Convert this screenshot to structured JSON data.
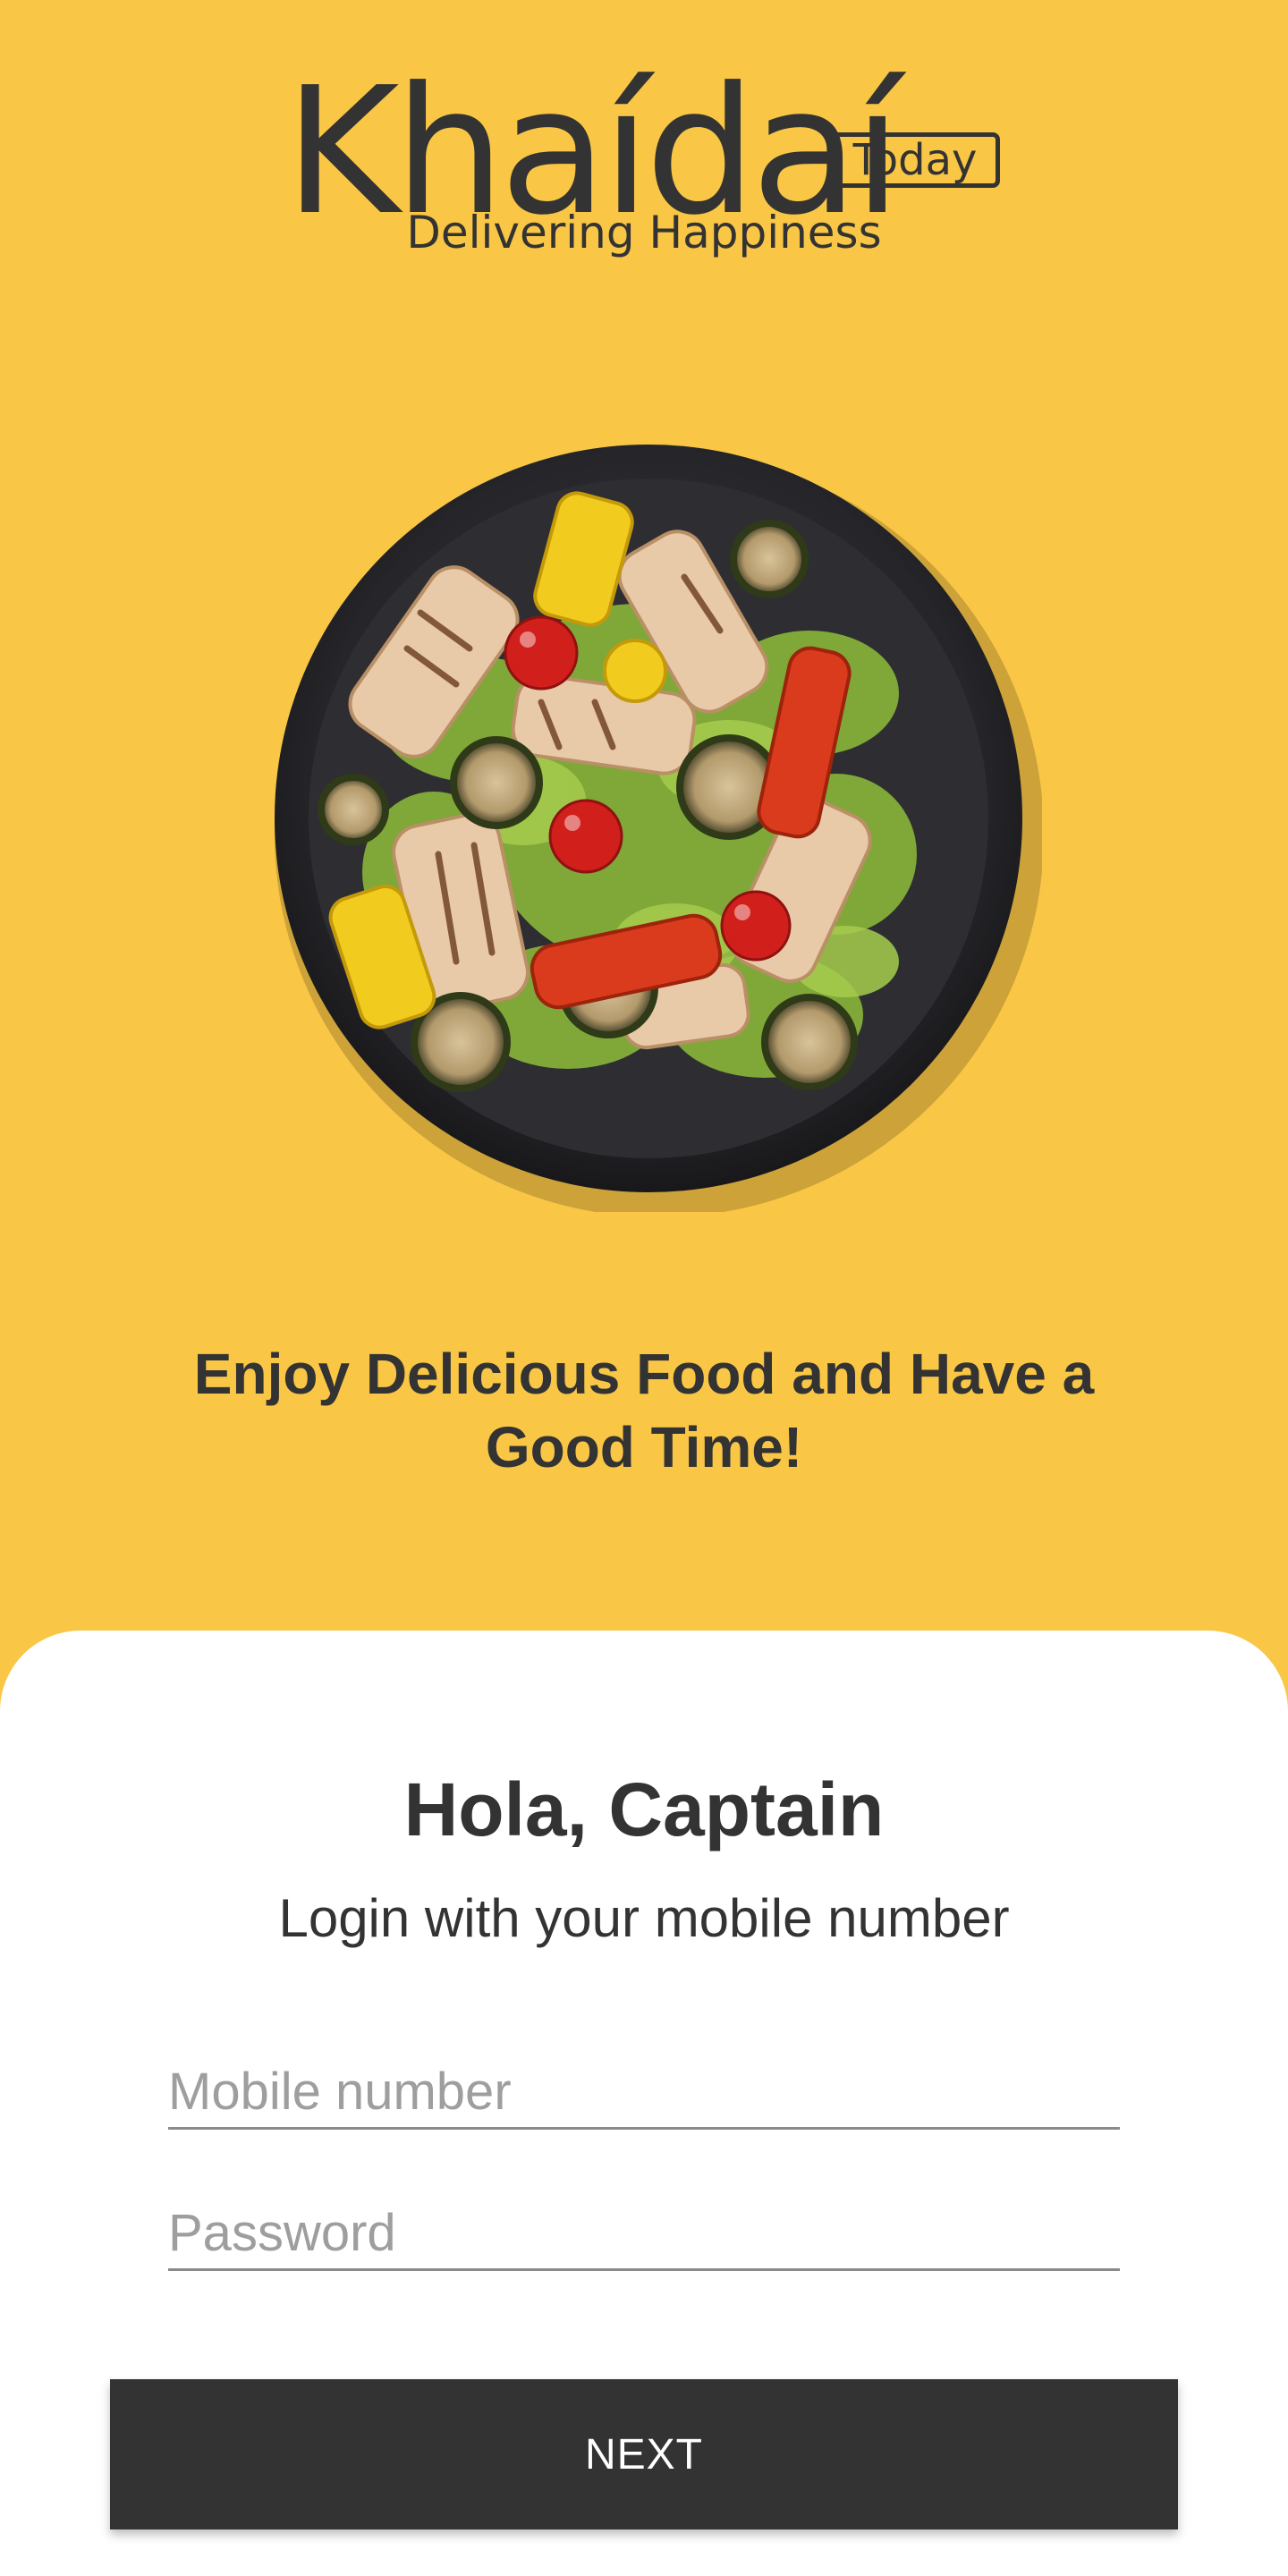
{
  "brand": {
    "name": "Khaídaí",
    "badge": "Today",
    "tagline": "Delivering Happiness"
  },
  "hero": {
    "image": "food-plate-salad",
    "headline": "Enjoy Delicious Food and Have a Good Time!"
  },
  "login": {
    "title": "Hola, Captain",
    "subtitle": "Login with your mobile number",
    "mobile_placeholder": "Mobile number",
    "password_placeholder": "Password",
    "next_label": "NEXT"
  },
  "colors": {
    "background": "#F9C646",
    "card": "#FFFFFF",
    "text": "#333333",
    "button": "#333333",
    "button_text": "#FFFFFF"
  }
}
